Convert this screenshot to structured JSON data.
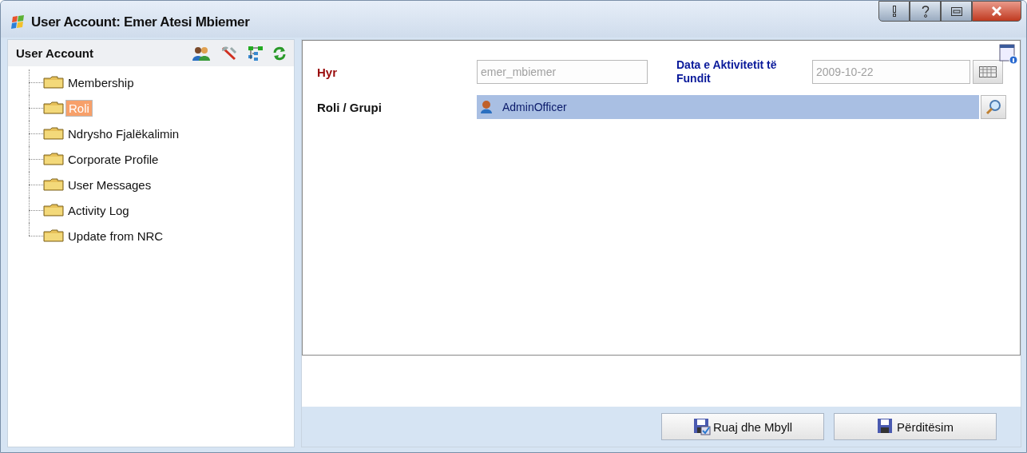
{
  "window": {
    "title": "User Account: Emer Atesi Mbiemer"
  },
  "sidebar": {
    "title": "User Account",
    "items": [
      {
        "label": "Membership",
        "selected": false
      },
      {
        "label": "Roli",
        "selected": true
      },
      {
        "label": "Ndrysho Fjalëkalimin",
        "selected": false
      },
      {
        "label": "Corporate Profile",
        "selected": false
      },
      {
        "label": "User Messages",
        "selected": false
      },
      {
        "label": "Activity Log",
        "selected": false
      },
      {
        "label": "Update from NRC",
        "selected": false
      }
    ]
  },
  "form": {
    "login": {
      "label": "Hyr",
      "value": "emer_mbiemer",
      "disabled": true
    },
    "last_activity": {
      "label": "Data e Aktivitetit të Fundit",
      "value": "2009-10-22",
      "disabled": true
    },
    "role": {
      "label": "Roli / Grupi",
      "value": "AdminOfficer"
    }
  },
  "buttons": [
    "Ruaj dhe Mbyll",
    "Përditësim"
  ]
}
